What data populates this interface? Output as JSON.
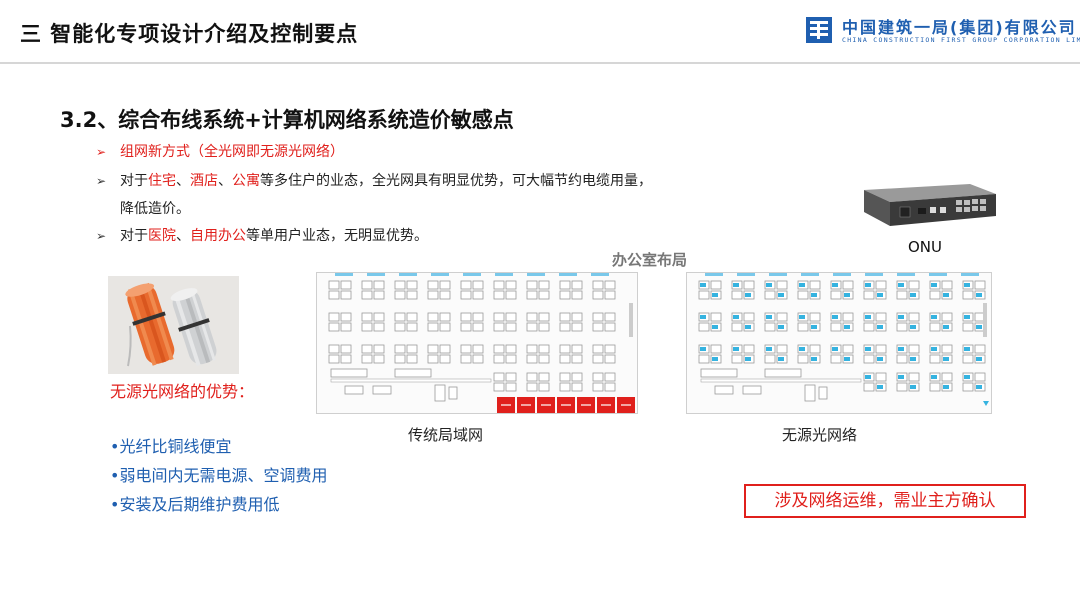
{
  "header": {
    "title": "三  智能化专项设计介绍及控制要点",
    "logo_cn": "中国建筑一局(集团)有限公司",
    "logo_en": "CHINA CONSTRUCTION FIRST GROUP CORPORATION LIMITED"
  },
  "section": {
    "title": "3.2、综合布线系统+计算机网络系统造价敏感点",
    "bullets": [
      {
        "marker": "➢",
        "text": "组网新方式（全光网即无源光网络）"
      },
      {
        "marker": "➢",
        "prefix": "对于",
        "highlight1": "住宅",
        "sep1": "、",
        "highlight2": "酒店",
        "sep2": "、",
        "highlight3": "公寓",
        "suffix": "等多住户的业态，全光网具有明显优势，可大幅节约电缆用量，",
        "continuation": "降低造价。"
      },
      {
        "marker": "➢",
        "prefix": "对于",
        "highlight1": "医院",
        "sep1": "、",
        "highlight2": "自用办公",
        "suffix": "等单用户业态，无明显优势。"
      }
    ]
  },
  "advantages": {
    "label": "无源光网络的优势：",
    "items": [
      "•光纤比铜线便宜",
      "•弱电间内无需电源、空调费用",
      "•安装及后期维护费用低"
    ]
  },
  "diagram": {
    "title": "办公室布局",
    "left_label": "传统局域网",
    "right_label": "无源光网络",
    "onu_label": "ONU"
  },
  "notice": "涉及网络运维，需业主方确认",
  "colors": {
    "accent_red": "#e0201c",
    "brand_blue": "#1f5fb0",
    "cyan": "#35b3e0"
  }
}
